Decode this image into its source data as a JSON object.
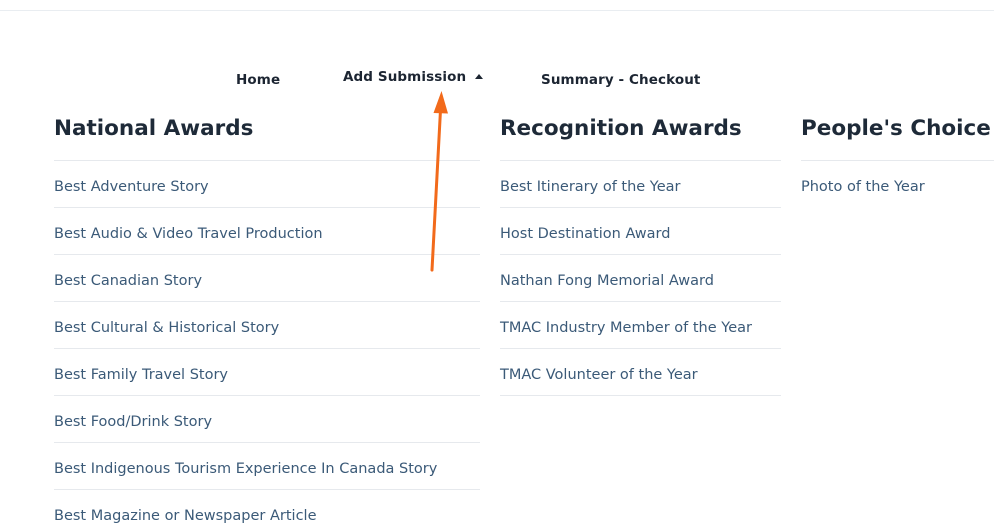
{
  "nav": {
    "home_label": "Home",
    "add_submission_label": "Add Submission",
    "summary_label": "Summary - Checkout"
  },
  "columns": {
    "national": {
      "heading": "National Awards",
      "items": [
        "Best Adventure Story",
        "Best Audio & Video Travel Production",
        "Best Canadian Story",
        "Best Cultural & Historical Story",
        "Best Family Travel Story",
        "Best Food/Drink Story",
        "Best Indigenous Tourism Experience In Canada Story",
        "Best Magazine or Newspaper Article"
      ]
    },
    "recognition": {
      "heading": "Recognition Awards",
      "items": [
        "Best Itinerary of the Year",
        "Host Destination Award",
        "Nathan Fong Memorial Award",
        "TMAC Industry Member of the Year",
        "TMAC Volunteer of the Year"
      ]
    },
    "people": {
      "heading": "People's Choice",
      "items": [
        "Photo of the Year"
      ]
    }
  },
  "colors": {
    "heading": "#1e2a38",
    "link": "#3b5a78",
    "annotation_arrow": "#f26a1b"
  },
  "icons": {
    "caret": "caret-up-icon"
  }
}
